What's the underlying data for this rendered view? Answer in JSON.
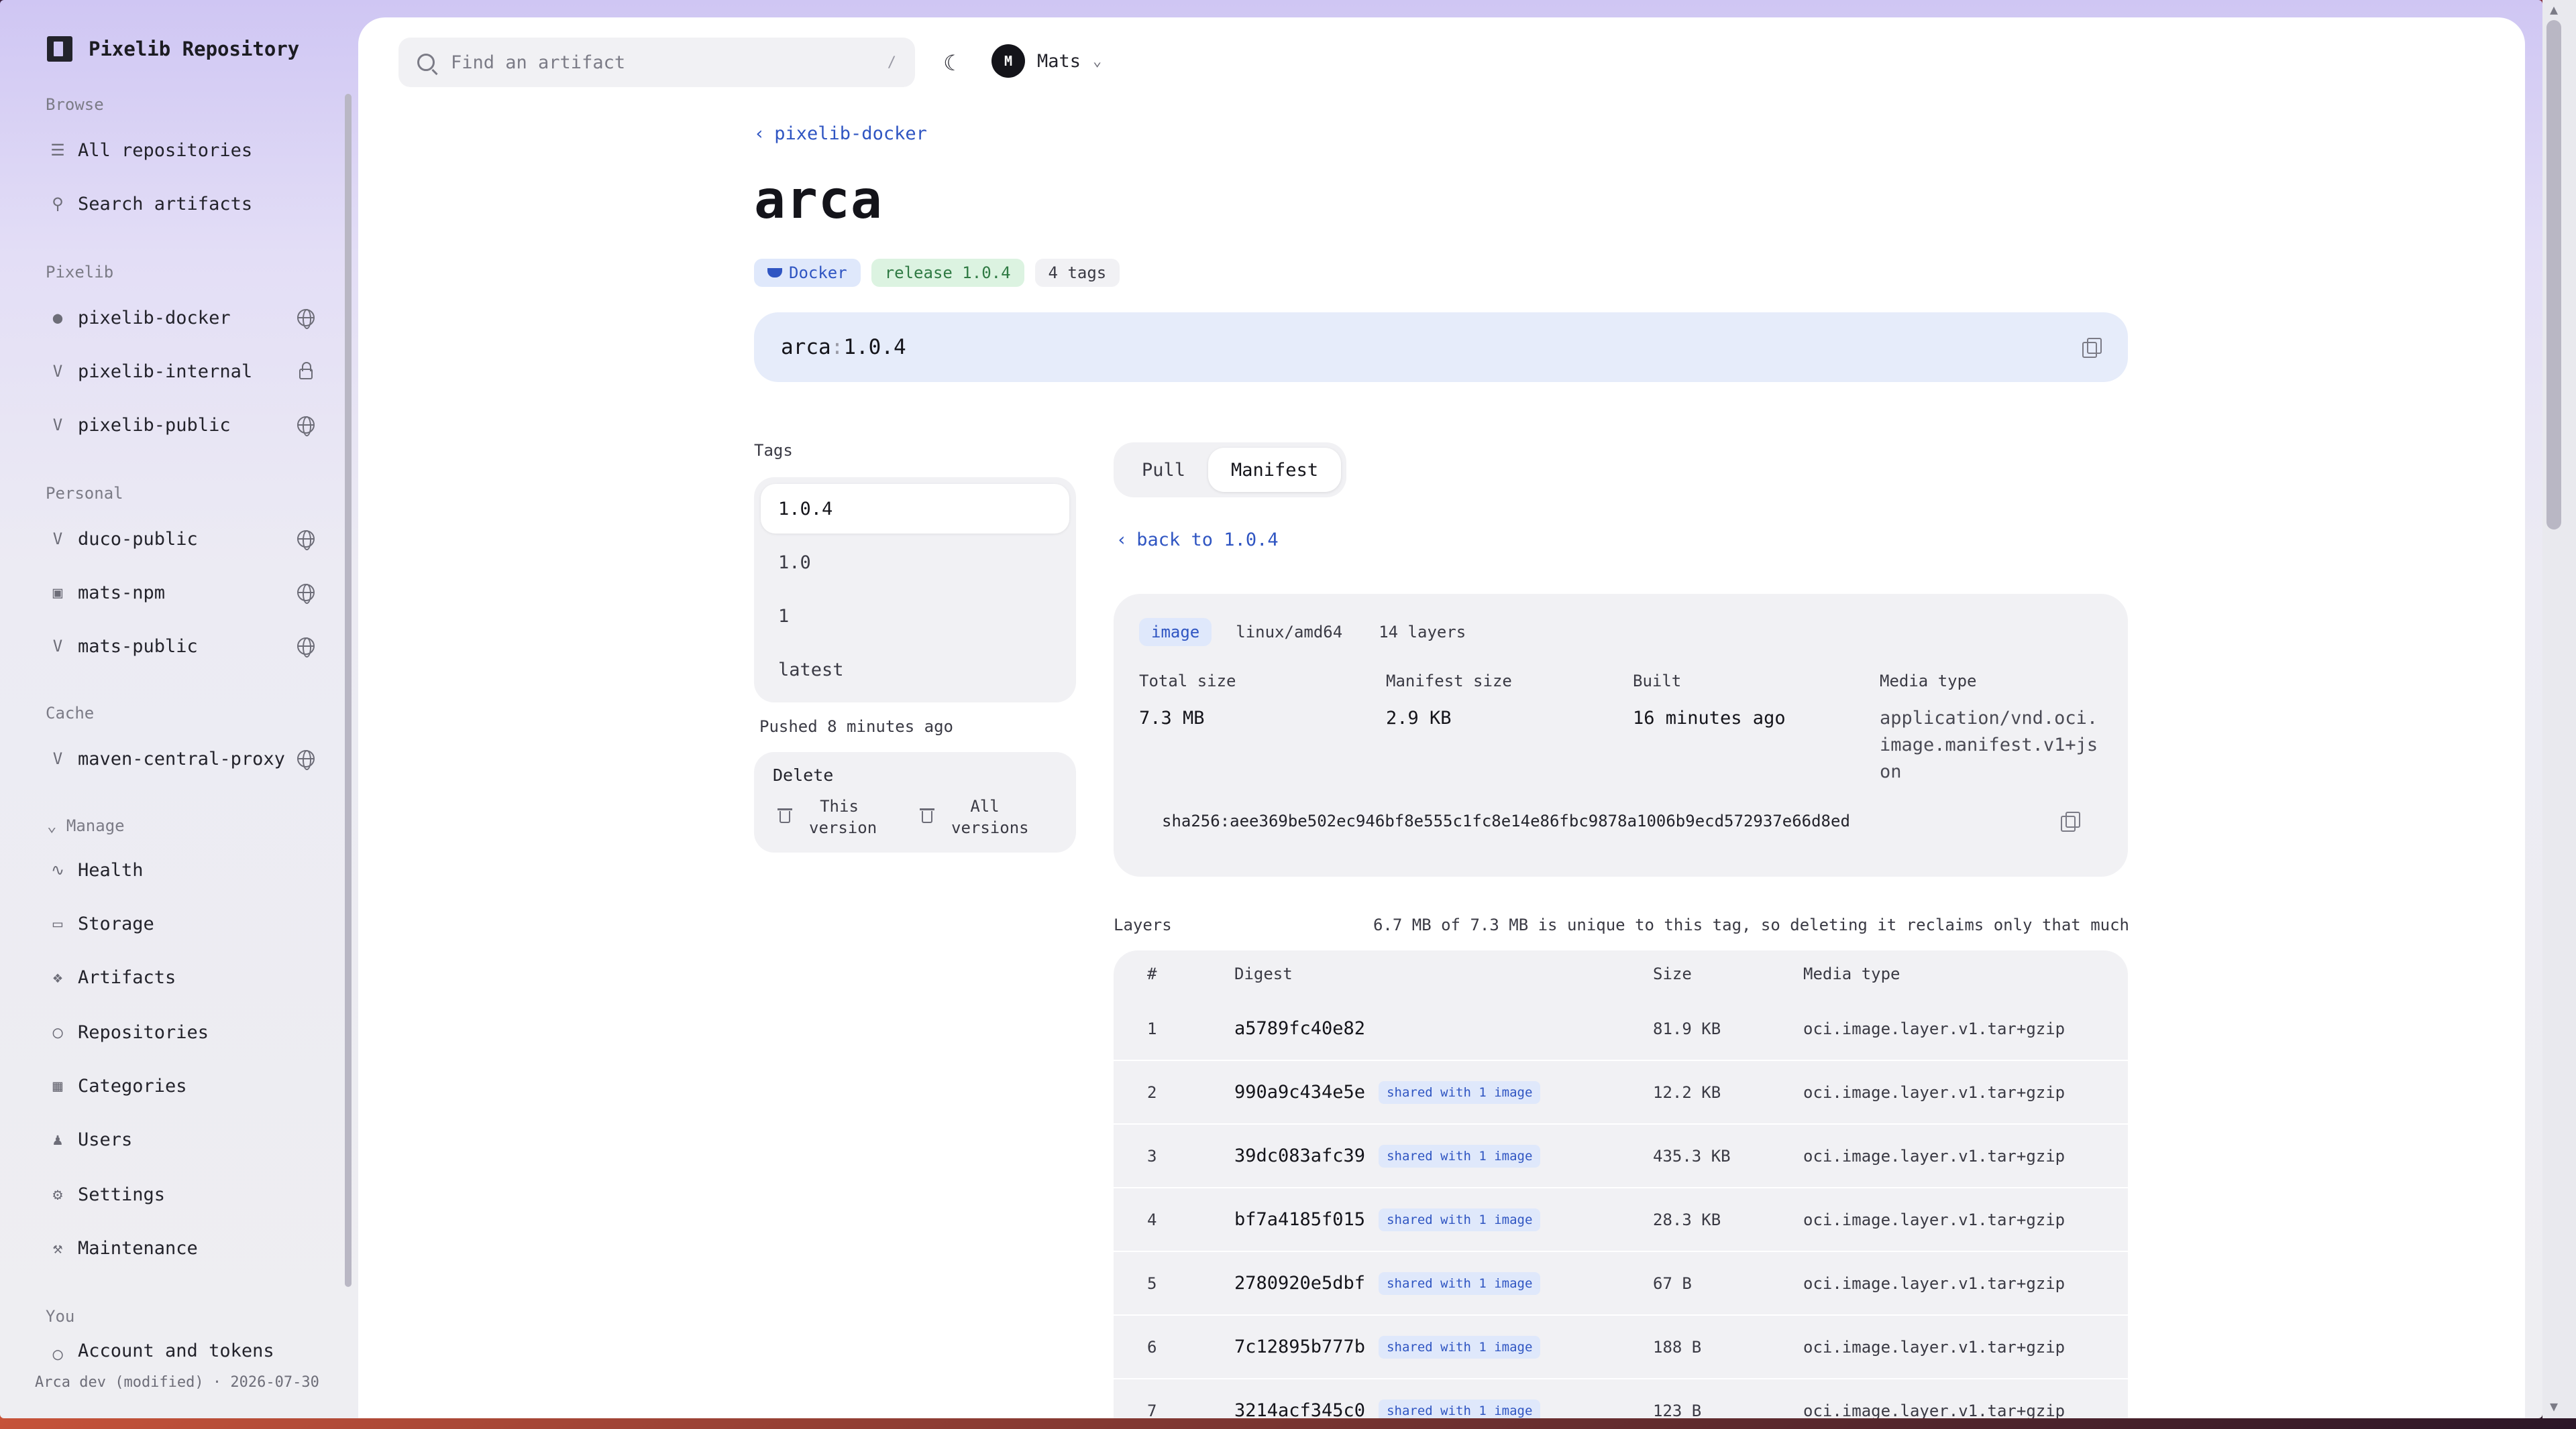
{
  "app": {
    "title": "Pixelib Repository"
  },
  "sidebar": {
    "sections": {
      "browse": "Browse",
      "pixelib": "Pixelib",
      "personal": "Personal",
      "cache": "Cache",
      "manage": "Manage",
      "you": "You"
    },
    "browse_items": [
      {
        "label": "All repositories",
        "icon": "library-icon"
      },
      {
        "label": "Search artifacts",
        "icon": "search-icon"
      }
    ],
    "pixelib_items": [
      {
        "label": "pixelib-docker",
        "icon": "docker-icon",
        "trail": "globe-icon"
      },
      {
        "label": "pixelib-internal",
        "icon": "maven-icon",
        "trail": "lock-icon"
      },
      {
        "label": "pixelib-public",
        "icon": "maven-icon",
        "trail": "globe-icon"
      }
    ],
    "personal_items": [
      {
        "label": "duco-public",
        "icon": "maven-icon",
        "trail": "globe-icon"
      },
      {
        "label": "mats-npm",
        "icon": "npm-icon",
        "trail": "globe-icon"
      },
      {
        "label": "mats-public",
        "icon": "maven-icon",
        "trail": "globe-icon"
      }
    ],
    "cache_items": [
      {
        "label": "maven-central-proxy",
        "icon": "maven-icon",
        "trail": "globe-icon"
      }
    ],
    "manage_items": [
      {
        "label": "Health",
        "icon": "activity-icon"
      },
      {
        "label": "Storage",
        "icon": "hard-drive-icon"
      },
      {
        "label": "Artifacts",
        "icon": "boxes-icon"
      },
      {
        "label": "Repositories",
        "icon": "shield-icon"
      },
      {
        "label": "Categories",
        "icon": "categories-icon"
      },
      {
        "label": "Users",
        "icon": "users-icon"
      },
      {
        "label": "Settings",
        "icon": "gear-icon"
      },
      {
        "label": "Maintenance",
        "icon": "wrench-icon"
      }
    ],
    "you_items": [
      {
        "label": "Account and tokens",
        "icon": "account-icon"
      }
    ],
    "footer": "Arca dev (modified) · 2026-07-30"
  },
  "topbar": {
    "search_placeholder": "Find an artifact",
    "search_shortcut": "/",
    "user_initial": "M",
    "user_name": "Mats"
  },
  "page": {
    "breadcrumb": "pixelib-docker",
    "title": "arca",
    "badges": {
      "docker": "Docker",
      "release": "release 1.0.4",
      "tags": "4 tags"
    },
    "ref": {
      "name": "arca",
      "sep": ":",
      "tag": "1.0.4"
    },
    "tags_label": "Tags",
    "tags": [
      "1.0.4",
      "1.0",
      "1",
      "latest"
    ],
    "pushed": "Pushed 8 minutes ago",
    "delete": {
      "title": "Delete",
      "this_version": "This version",
      "all_versions": "All versions"
    },
    "view_tabs": [
      "Pull",
      "Manifest"
    ],
    "back_link": "back to 1.0.4",
    "manifest": {
      "chips": [
        "image",
        "linux/amd64",
        "14 layers"
      ],
      "total_size_label": "Total size",
      "total_size": "7.3 MB",
      "manifest_size_label": "Manifest size",
      "manifest_size": "2.9 KB",
      "built_label": "Built",
      "built": "16 minutes ago",
      "media_type_label": "Media type",
      "media_type": "application/vnd.oci.image.manifest.v1+json",
      "digest": "sha256:aee369be502ec946bf8e555c1fc8e14e86fbc9878a1006b9ecd572937e66d8ed"
    },
    "layers_label": "Layers",
    "layers_note": "6.7 MB of 7.3 MB is unique to this tag, so deleting it reclaims only that much",
    "layers_columns": [
      "#",
      "Digest",
      "Size",
      "Media type"
    ],
    "layers": [
      {
        "n": "1",
        "digest": "a5789fc40e82",
        "shared": "",
        "size": "81.9 KB",
        "media": "oci.image.layer.v1.tar+gzip"
      },
      {
        "n": "2",
        "digest": "990a9c434e5e",
        "shared": "shared with 1 image",
        "size": "12.2 KB",
        "media": "oci.image.layer.v1.tar+gzip"
      },
      {
        "n": "3",
        "digest": "39dc083afc39",
        "shared": "shared with 1 image",
        "size": "435.3 KB",
        "media": "oci.image.layer.v1.tar+gzip"
      },
      {
        "n": "4",
        "digest": "bf7a4185f015",
        "shared": "shared with 1 image",
        "size": "28.3 KB",
        "media": "oci.image.layer.v1.tar+gzip"
      },
      {
        "n": "5",
        "digest": "2780920e5dbf",
        "shared": "shared with 1 image",
        "size": "67 B",
        "media": "oci.image.layer.v1.tar+gzip"
      },
      {
        "n": "6",
        "digest": "7c12895b777b",
        "shared": "shared with 1 image",
        "size": "188 B",
        "media": "oci.image.layer.v1.tar+gzip"
      },
      {
        "n": "7",
        "digest": "3214acf345c0",
        "shared": "shared with 1 image",
        "size": "123 B",
        "media": "oci.image.layer.v1.tar+gzip"
      }
    ]
  }
}
